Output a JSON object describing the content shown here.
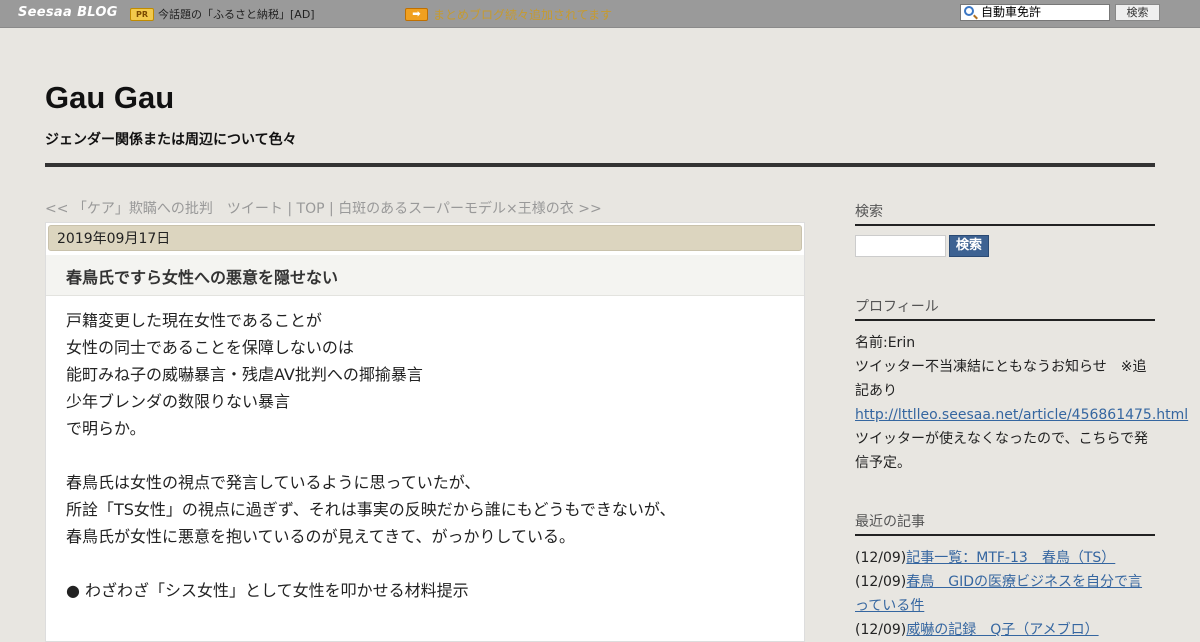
{
  "topbar": {
    "logo_main": "Seesaa",
    "logo_blog": "BLOG",
    "pr_badge": "PR",
    "pr_text": "今話題の「ふるさと納税」[AD]",
    "arrow_badge": "➡",
    "promo_text": "まとめブログ続々追加されてます",
    "search_value": "自動車免許",
    "search_button": "検索"
  },
  "header": {
    "title": "Gau Gau",
    "subtitle": "ジェンダー関係または周辺について色々"
  },
  "nav": {
    "prev": "<< 「ケア」欺瞞への批判　ツイート",
    "sep1": " | ",
    "top": "TOP",
    "sep2": " | ",
    "next": "白斑のあるスーパーモデル×王様の衣 >>"
  },
  "post": {
    "date": "2019年09月17日",
    "title": "春鳥氏ですら女性への悪意を隠せない",
    "lines": [
      "戸籍変更した現在女性であることが",
      "女性の同士であることを保障しないのは",
      "能町みね子の威嚇暴言・残虐AV批判への揶揄暴言",
      "少年ブレンダの数限りない暴言",
      "で明らか。",
      "",
      "春鳥氏は女性の視点で発言しているように思っていたが、",
      "所詮「TS女性」の視点に過ぎず、それは事実の反映だから誰にもどうもできないが、",
      "春鳥氏が女性に悪意を抱いているのが見えてきて、がっかりしている。",
      "",
      "● わざわざ「シス女性」として女性を叩かせる材料提示"
    ]
  },
  "sidebar": {
    "search": {
      "heading": "検索",
      "button": "検索"
    },
    "profile": {
      "heading": "プロフィール",
      "name": "名前:Erin",
      "notice": "ツイッター不当凍結にともなうお知らせ　※追記あり",
      "link": "http://lttlleo.seesaa.net/article/456861475.html",
      "note": "ツイッターが使えなくなったので、こちらで発信予定。"
    },
    "recent": {
      "heading": "最近の記事",
      "items": [
        {
          "date": "(12/09)",
          "title": "記事一覧：MTF-13　春鳥（TS）"
        },
        {
          "date": "(12/09)",
          "title": "春鳥　GIDの医療ビジネスを自分で言っている件"
        },
        {
          "date": "(12/09)",
          "title": "威嚇の記録　Q子（アメブロ）"
        }
      ]
    }
  },
  "colors": {
    "background": "#e8e6e1",
    "topbar": "#9a9a9a",
    "date_bar": "#dcd5bf",
    "link": "#3566a0",
    "search_button": "#3d6292"
  }
}
